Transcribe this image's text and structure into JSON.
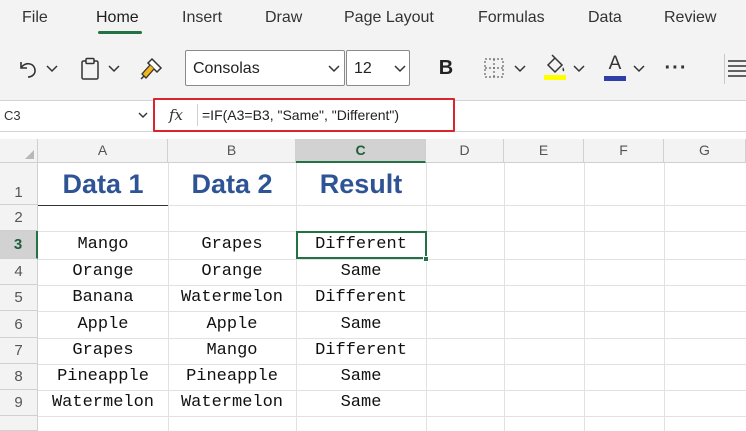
{
  "menu": {
    "tabs": [
      {
        "label": "File"
      },
      {
        "label": "Home"
      },
      {
        "label": "Insert"
      },
      {
        "label": "Draw"
      },
      {
        "label": "Page Layout"
      },
      {
        "label": "Formulas"
      },
      {
        "label": "Data"
      },
      {
        "label": "Review"
      }
    ],
    "active_tab": "Home"
  },
  "ribbon": {
    "font_name": "Consolas",
    "font_size": "12",
    "bold_label": "B",
    "font_color_label": "A",
    "more_label": "···",
    "icons": [
      "undo-icon",
      "paste-icon",
      "format-painter-icon",
      "borders-icon",
      "fill-color-icon",
      "font-color-icon",
      "more-icon",
      "align-icon"
    ],
    "colors": {
      "fill_accent": "#ffff00",
      "font_accent": "#2f3fa8",
      "brand": "#217346"
    }
  },
  "formula_bar": {
    "name_box": "C3",
    "fx_label": "fx",
    "formula": "=IF(A3=B3, \"Same\", \"Different\")"
  },
  "sheet": {
    "columns": [
      "A",
      "B",
      "C",
      "D",
      "E",
      "F",
      "G"
    ],
    "rows": [
      "1",
      "2",
      "3",
      "4",
      "5",
      "6",
      "7",
      "8",
      "9"
    ],
    "selected_cell": "C3",
    "headers": [
      "Data 1",
      "Data 2",
      "Result"
    ],
    "data": [
      [
        "Mango",
        "Grapes",
        "Different"
      ],
      [
        "Orange",
        "Orange",
        "Same"
      ],
      [
        "Banana",
        "Watermelon",
        "Different"
      ],
      [
        "Apple",
        "Apple",
        "Same"
      ],
      [
        "Grapes",
        "Mango",
        "Different"
      ],
      [
        "Pineapple",
        "Pineapple",
        "Same"
      ],
      [
        "Watermelon",
        "Watermelon",
        "Same"
      ]
    ],
    "header_color": "#2f5496"
  }
}
